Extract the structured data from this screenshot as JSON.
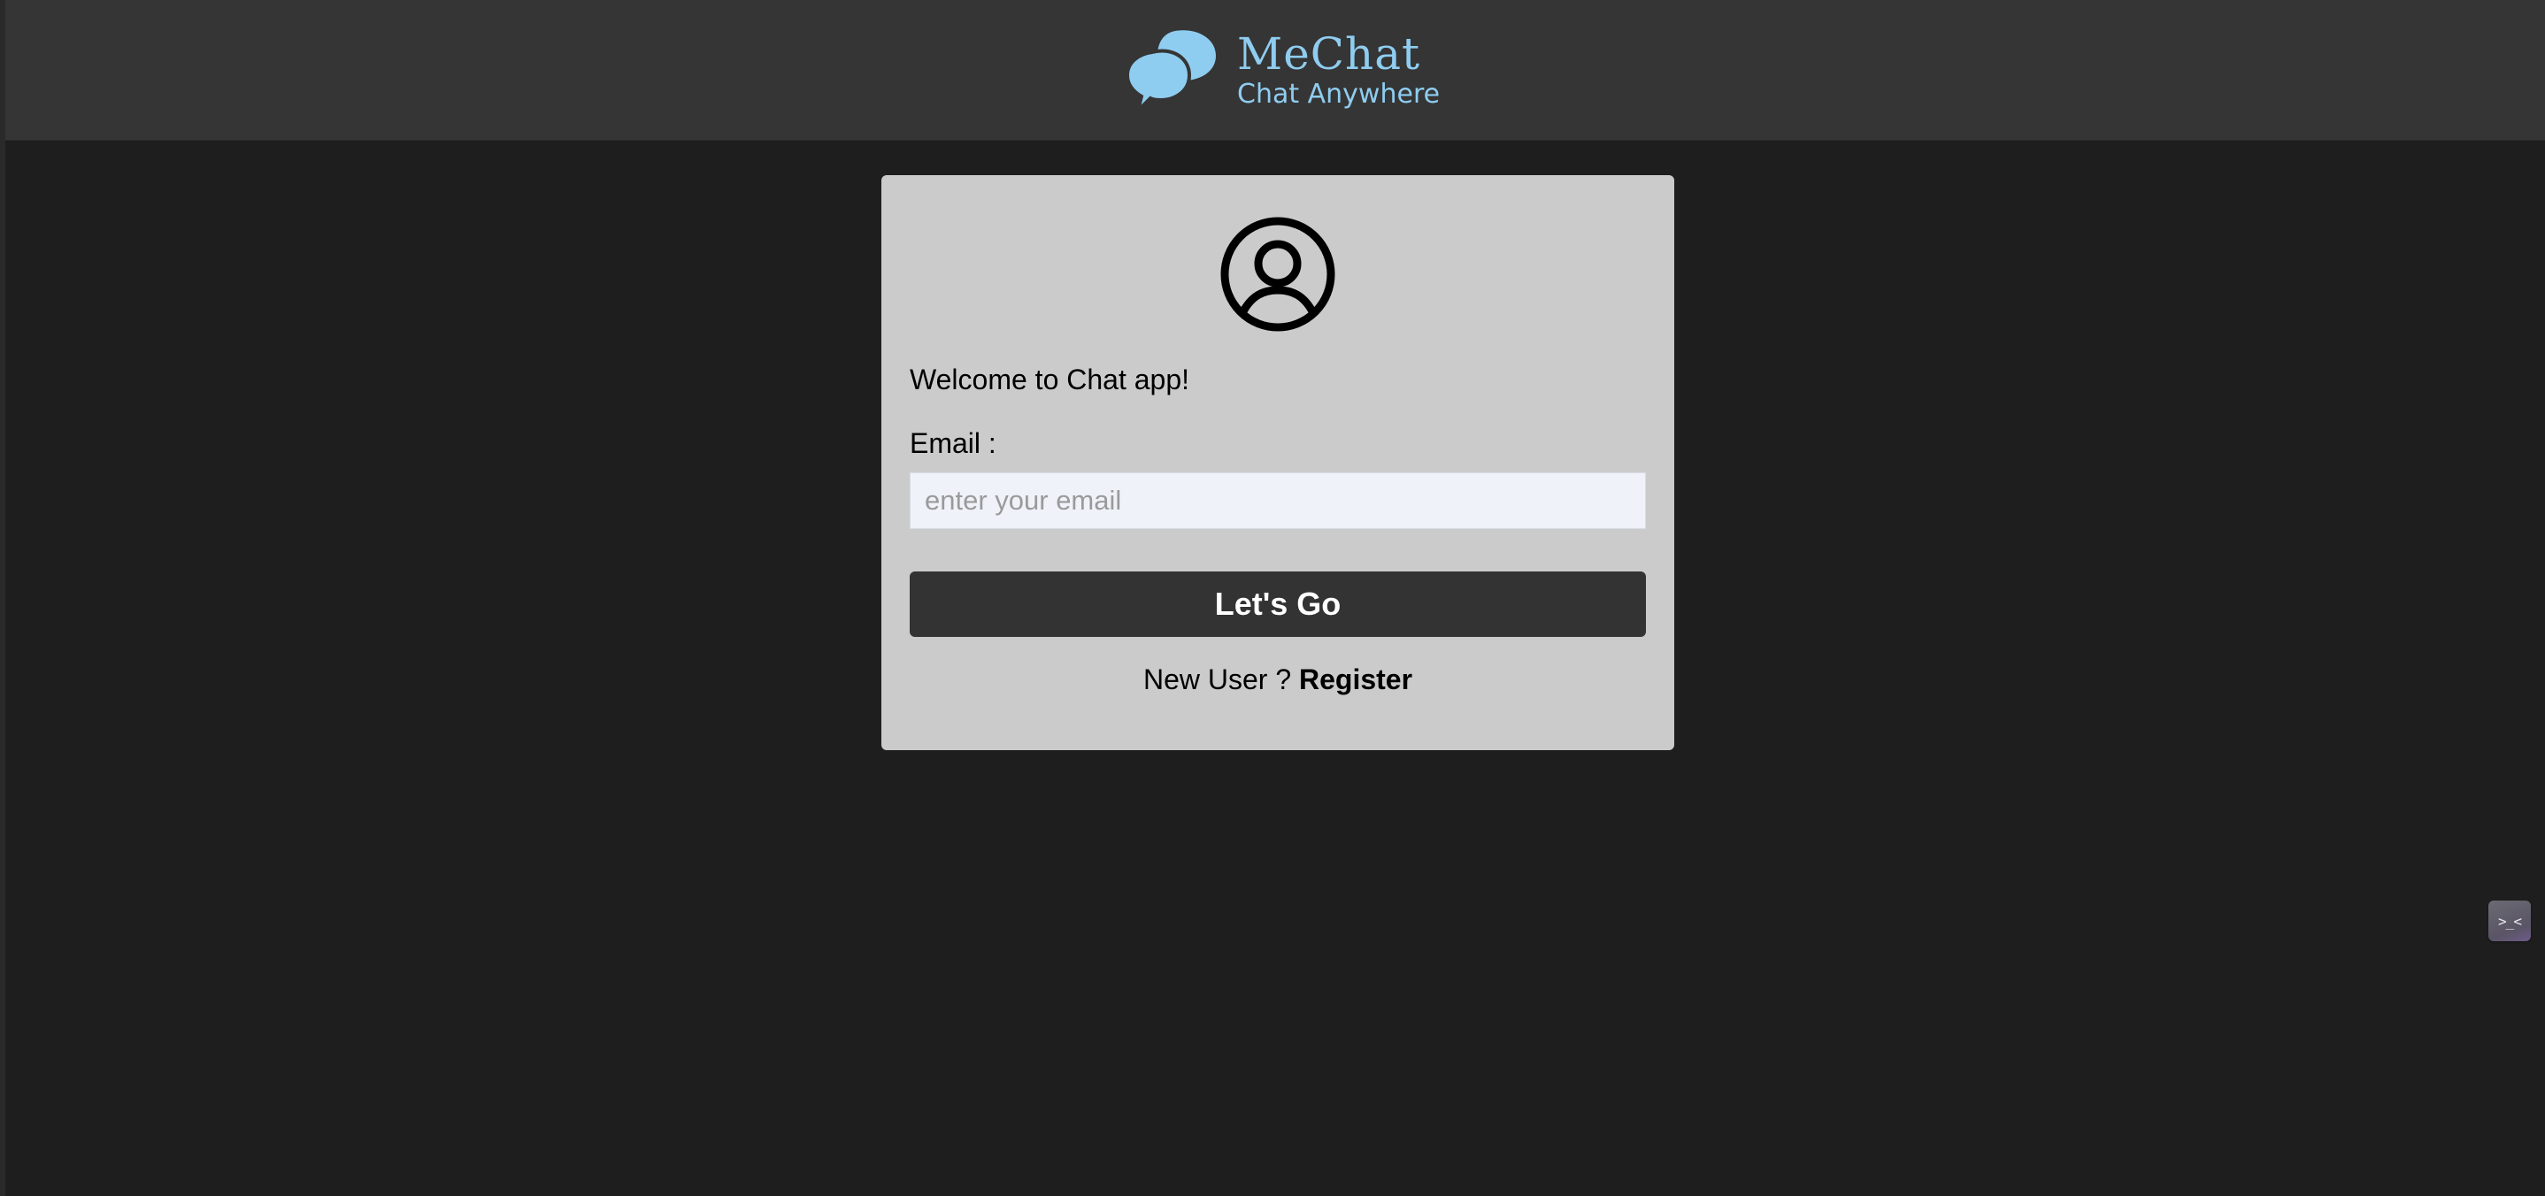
{
  "header": {
    "brand_name": "MeChat",
    "brand_tagline": "Chat Anywhere",
    "logo_icon": "chat-bubbles-icon",
    "accent_color": "#8fcdf0",
    "background_color": "#353535"
  },
  "login": {
    "avatar_icon": "user-circle-icon",
    "welcome_text": "Welcome to Chat app!",
    "email_label": "Email :",
    "email_placeholder": "enter your email",
    "email_value": "",
    "submit_label": "Let's Go",
    "register_prompt": "New User ?",
    "register_link": "Register",
    "card_color": "#cbcbcb",
    "button_color": "#333333"
  },
  "widget": {
    "icon": "face-icon",
    "glyph": ">_<"
  }
}
